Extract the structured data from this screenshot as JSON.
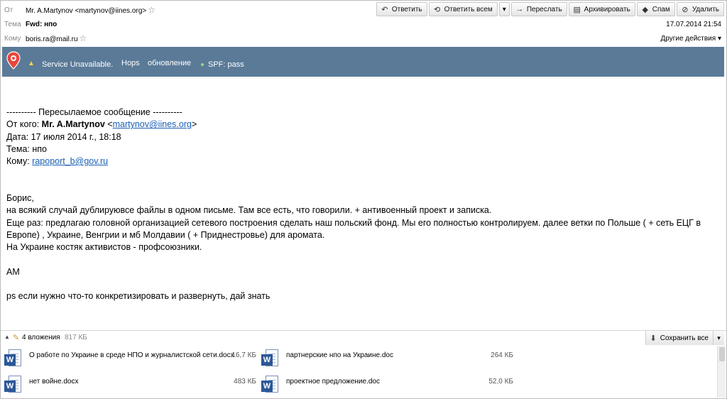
{
  "header": {
    "from_label": "От",
    "from_value": "Mr. A.Martynov <martynov@iines.org>",
    "subject_label": "Тема",
    "subject_value": "Fwd: нпо",
    "to_label": "Кому",
    "to_value": "boris.ra@mail.ru",
    "date": "17.07.2014 21:54",
    "other_actions": "Другие действия"
  },
  "toolbar": {
    "reply": "Ответить",
    "reply_all": "Ответить всем",
    "forward": "Переслать",
    "archive": "Архивировать",
    "spam": "Спам",
    "delete": "Удалить"
  },
  "banner": {
    "status": "Service Unavailable.",
    "btn1": "Hops",
    "btn2": "обновление",
    "spf": "SPF: pass"
  },
  "body": {
    "fwd_header": "---------- Пересылаемое сообщение ----------",
    "from_prefix": "От кого: ",
    "from_name": "Mr. A.Martynov",
    "from_email": "martynov@iines.org",
    "date_line": "Дата: 17 июля 2014 г., 18:18",
    "subject_line": "Тема: нпо",
    "to_prefix": "Кому: ",
    "to_email": "rapoport_b@gov.ru",
    "greeting": "Борис,",
    "p1": "на всякий случай дублируювсе файлы в одном письме. Там все есть, что говорили. + антивоенный проект и записка.",
    "p2": "Еще раз: предлагаю головной организацией сетевого построения сделать наш польский фонд. Мы его полностью контролируем. далее ветки по Польше ( + сеть ЕЦГ в Европе) , Украине, Венгрии и мб Молдавии ( + Приднестровье) для аромата.",
    "p3": "На Украине костяк активистов - профсоюзники.",
    "sig": "АМ",
    "ps": "ps если нужно что-то конкретизировать и развернуть, дай знать"
  },
  "attachments": {
    "count_label": "4 вложения",
    "total_size": "817 КБ",
    "save_all": "Сохранить все",
    "items": [
      {
        "name": "О работе по Украине в среде НПО и журналистской сети.docx",
        "size": "16,7 КБ"
      },
      {
        "name": "партнерские нпо на Украине.doc",
        "size": "264 КБ"
      },
      {
        "name": "нет войне.docx",
        "size": "483 КБ"
      },
      {
        "name": "проектное предложение.doc",
        "size": "52,0 КБ"
      }
    ]
  },
  "icons": {
    "reply": "reply-icon",
    "reply_all": "reply-all-icon",
    "forward": "forward-icon",
    "archive": "archive-icon",
    "spam": "spam-icon",
    "delete": "delete-icon",
    "word": "word-document-icon",
    "paperclip": "paperclip-icon",
    "warning": "warning-icon",
    "star": "star-icon"
  },
  "colors": {
    "banner": "#5a7a98",
    "link": "#1a5fb4",
    "word": "#2b5797"
  }
}
